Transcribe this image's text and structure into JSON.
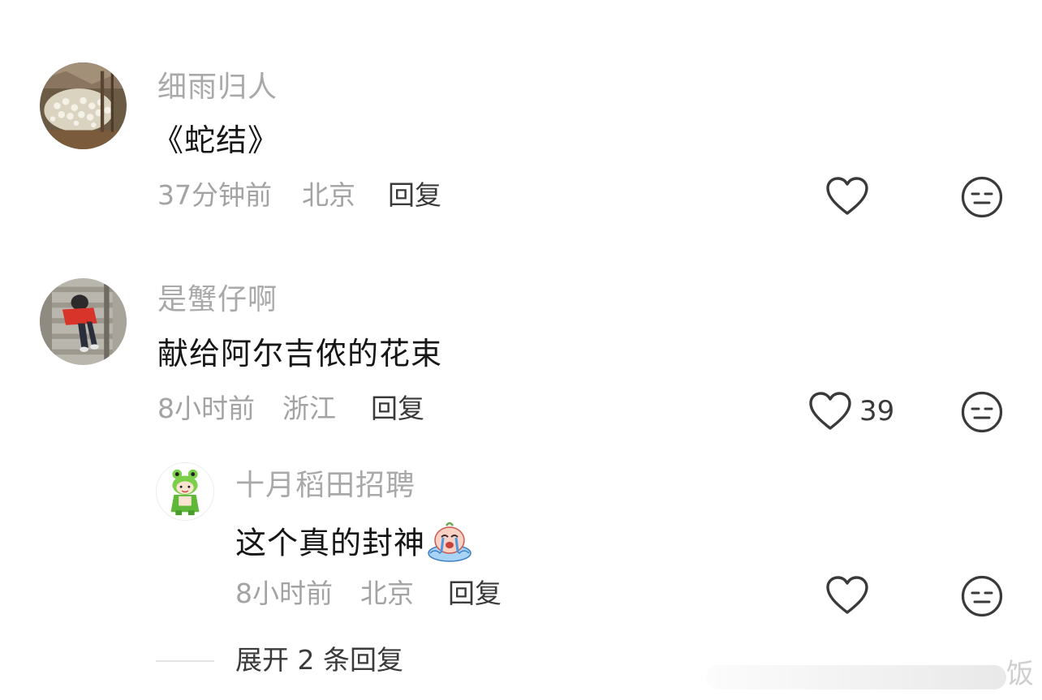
{
  "comments": [
    {
      "username": "细雨归人",
      "text": "《蛇结》",
      "time": "37分钟前",
      "location": "北京",
      "reply_label": "回复",
      "like_count": "",
      "avatar_icon": "flowers-photo-avatar"
    },
    {
      "username": "是蟹仔啊",
      "text": "献给阿尔吉侬的花束",
      "time": "8小时前",
      "location": "浙江",
      "reply_label": "回复",
      "like_count": "39",
      "avatar_icon": "stairs-photo-avatar",
      "replies": [
        {
          "username": "十月稻田招聘",
          "text": "这个真的封神",
          "emoji": "crying-emoji",
          "time": "8小时前",
          "location": "北京",
          "reply_label": "回复",
          "avatar_icon": "green-frog-mascot-avatar"
        }
      ]
    }
  ],
  "expand_replies_label": "展开 2 条回复",
  "watermark_text": "饭",
  "icons": {
    "like": "heart-outline-icon",
    "dislike": "neutral-face-icon"
  },
  "colors": {
    "username": "#a9a9a9",
    "content": "#161616",
    "meta": "#a3a3a3",
    "action": "#3a3a3a"
  }
}
